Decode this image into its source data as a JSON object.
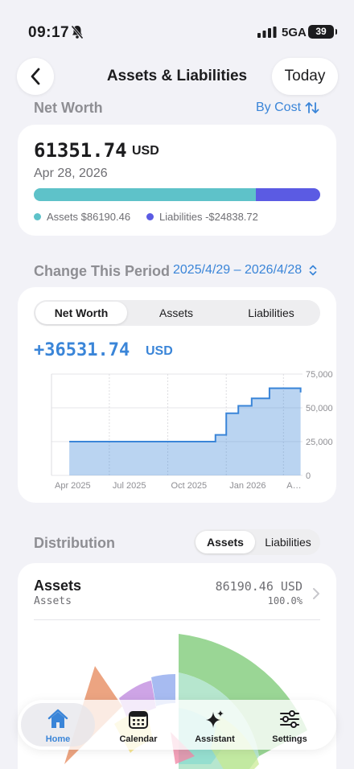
{
  "status_bar": {
    "time": "09:17",
    "network": "5GA",
    "battery": "39"
  },
  "nav": {
    "title": "Assets & Liabilities",
    "today_label": "Today"
  },
  "net_worth": {
    "header": "Net Worth",
    "sort_label": "By Cost",
    "value": "61351.74",
    "currency": "USD",
    "date": "Apr 28, 2026",
    "assets_fraction": 0.776,
    "assets_legend": "Assets $86190.46",
    "liabilities_legend": "Liabilities -$24838.72",
    "colors": {
      "assets": "#5ec2c9",
      "liabilities": "#5b5be3"
    }
  },
  "change": {
    "header": "Change This Period",
    "range": "2025/4/29 – 2026/4/28",
    "tabs": [
      "Net Worth",
      "Assets",
      "Liabilities"
    ],
    "active_tab": 0,
    "value": "+36531.74",
    "currency": "USD"
  },
  "chart_data": {
    "type": "area",
    "title": "",
    "xlabel": "",
    "ylabel": "",
    "x_tick_labels": [
      "Apr 2025",
      "Jul 2025",
      "Oct 2025",
      "Jan 2026",
      "A…"
    ],
    "y_tick_labels": [
      "75,000",
      "50,000",
      "25,000",
      "0"
    ],
    "ylim": [
      0,
      75000
    ],
    "step": true,
    "grid": true,
    "color": "#3a85d8",
    "series": [
      {
        "x": [
          "2025-04-29",
          "2025-11-15",
          "2025-12-15",
          "2026-01-01",
          "2026-01-20",
          "2026-02-10",
          "2026-03-10",
          "2026-04-28"
        ],
        "values": [
          25000,
          25000,
          30000,
          46000,
          51500,
          57000,
          64500,
          61351.74
        ]
      }
    ]
  },
  "distribution": {
    "header": "Distribution",
    "tabs": [
      "Assets",
      "Liabilities"
    ],
    "active_tab": 0,
    "asset_title": "Assets",
    "asset_sub": "Assets",
    "asset_value": "86190.46 USD",
    "asset_pct": "100.0%"
  },
  "tab_bar": {
    "items": [
      {
        "label": "Home",
        "icon": "house-icon"
      },
      {
        "label": "Calendar",
        "icon": "calendar-icon"
      },
      {
        "label": "Assistant",
        "icon": "sparkles-icon"
      },
      {
        "label": "Settings",
        "icon": "sliders-icon"
      }
    ],
    "active": 0
  }
}
